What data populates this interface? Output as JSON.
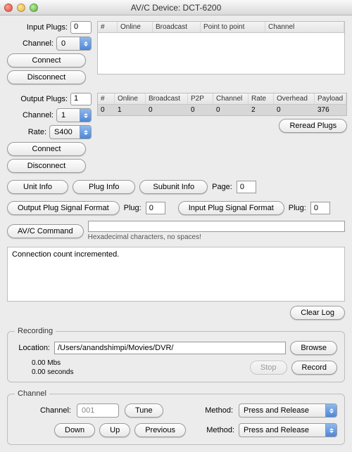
{
  "window": {
    "title": "AV/C Device: DCT-6200"
  },
  "inputPlugs": {
    "label": "Input Plugs:",
    "count": "0",
    "channelLabel": "Channel:",
    "channelValue": "0",
    "connect": "Connect",
    "disconnect": "Disconnect",
    "columns": [
      "#",
      "Online",
      "Broadcast",
      "Point to point",
      "Channel"
    ]
  },
  "outputPlugs": {
    "label": "Output Plugs:",
    "count": "1",
    "channelLabel": "Channel:",
    "channelValue": "1",
    "rateLabel": "Rate:",
    "rateValue": "S400",
    "connect": "Connect",
    "disconnect": "Disconnect",
    "columns": [
      "#",
      "Online",
      "Broadcast",
      "P2P",
      "Channel",
      "Rate",
      "Overhead",
      "Payload"
    ],
    "rows": [
      {
        "cells": [
          "0",
          "1",
          "0",
          "0",
          "0",
          "2",
          "0",
          "376"
        ]
      }
    ]
  },
  "rereadPlugs": "Reread Plugs",
  "infoRow": {
    "unit": "Unit Info",
    "plug": "Plug Info",
    "subunit": "Subunit Info",
    "pageLabel": "Page:",
    "pageValue": "0"
  },
  "sigRow": {
    "out": "Output Plug Signal Format",
    "outPlugLabel": "Plug:",
    "outPlugValue": "0",
    "in": "Input Plug Signal Format",
    "inPlugLabel": "Plug:",
    "inPlugValue": "0"
  },
  "avc": {
    "button": "AV/C Command",
    "value": "",
    "hint": "Hexadecimal characters, no spaces!"
  },
  "log": {
    "text": "Connection count incremented.",
    "clear": "Clear Log"
  },
  "recording": {
    "legend": "Recording",
    "locationLabel": "Location:",
    "locationValue": "/Users/anandshimpi/Movies/DVR/",
    "browse": "Browse",
    "statMbs": "0.00 Mbs",
    "statSec": "0.00 seconds",
    "stop": "Stop",
    "record": "Record"
  },
  "channel": {
    "legend": "Channel",
    "channelLabel": "Channel:",
    "channelValue": "001",
    "tune": "Tune",
    "method1Label": "Method:",
    "method1Value": "Press and Release",
    "down": "Down",
    "up": "Up",
    "previous": "Previous",
    "method2Label": "Method:",
    "method2Value": "Press and Release"
  }
}
